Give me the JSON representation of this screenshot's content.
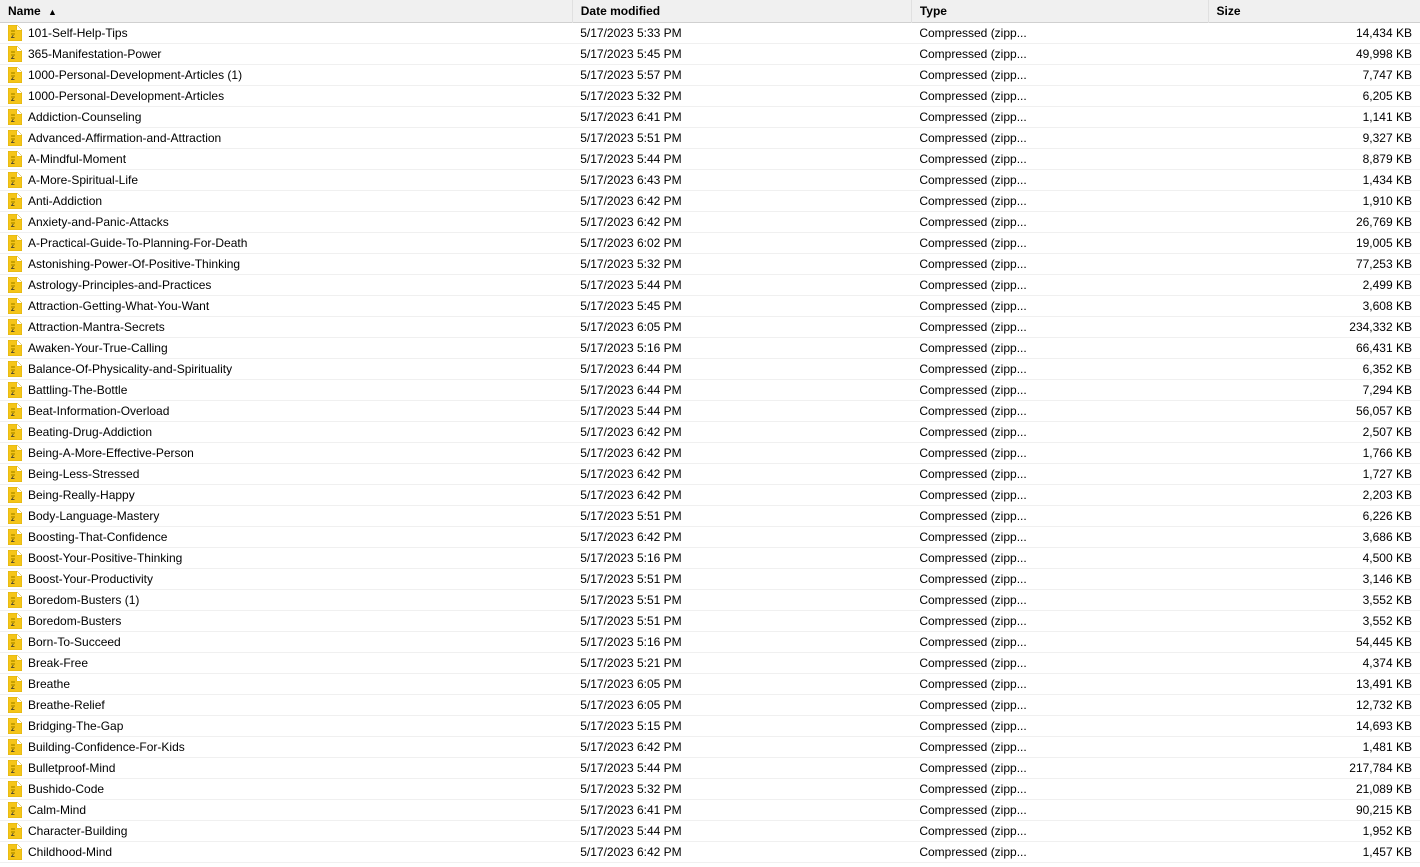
{
  "columns": {
    "name": "Name",
    "date": "Date modified",
    "type": "Type",
    "size": "Size"
  },
  "sort_arrow": "▲",
  "files": [
    {
      "name": "101-Self-Help-Tips",
      "date": "5/17/2023 5:33 PM",
      "type": "Compressed (zipp...",
      "size": "14,434 KB"
    },
    {
      "name": "365-Manifestation-Power",
      "date": "5/17/2023 5:45 PM",
      "type": "Compressed (zipp...",
      "size": "49,998 KB"
    },
    {
      "name": "1000-Personal-Development-Articles (1)",
      "date": "5/17/2023 5:57 PM",
      "type": "Compressed (zipp...",
      "size": "7,747 KB"
    },
    {
      "name": "1000-Personal-Development-Articles",
      "date": "5/17/2023 5:32 PM",
      "type": "Compressed (zipp...",
      "size": "6,205 KB"
    },
    {
      "name": "Addiction-Counseling",
      "date": "5/17/2023 6:41 PM",
      "type": "Compressed (zipp...",
      "size": "1,141 KB"
    },
    {
      "name": "Advanced-Affirmation-and-Attraction",
      "date": "5/17/2023 5:51 PM",
      "type": "Compressed (zipp...",
      "size": "9,327 KB"
    },
    {
      "name": "A-Mindful-Moment",
      "date": "5/17/2023 5:44 PM",
      "type": "Compressed (zipp...",
      "size": "8,879 KB"
    },
    {
      "name": "A-More-Spiritual-Life",
      "date": "5/17/2023 6:43 PM",
      "type": "Compressed (zipp...",
      "size": "1,434 KB"
    },
    {
      "name": "Anti-Addiction",
      "date": "5/17/2023 6:42 PM",
      "type": "Compressed (zipp...",
      "size": "1,910 KB"
    },
    {
      "name": "Anxiety-and-Panic-Attacks",
      "date": "5/17/2023 6:42 PM",
      "type": "Compressed (zipp...",
      "size": "26,769 KB"
    },
    {
      "name": "A-Practical-Guide-To-Planning-For-Death",
      "date": "5/17/2023 6:02 PM",
      "type": "Compressed (zipp...",
      "size": "19,005 KB"
    },
    {
      "name": "Astonishing-Power-Of-Positive-Thinking",
      "date": "5/17/2023 5:32 PM",
      "type": "Compressed (zipp...",
      "size": "77,253 KB"
    },
    {
      "name": "Astrology-Principles-and-Practices",
      "date": "5/17/2023 5:44 PM",
      "type": "Compressed (zipp...",
      "size": "2,499 KB"
    },
    {
      "name": "Attraction-Getting-What-You-Want",
      "date": "5/17/2023 5:45 PM",
      "type": "Compressed (zipp...",
      "size": "3,608 KB"
    },
    {
      "name": "Attraction-Mantra-Secrets",
      "date": "5/17/2023 6:05 PM",
      "type": "Compressed (zipp...",
      "size": "234,332 KB"
    },
    {
      "name": "Awaken-Your-True-Calling",
      "date": "5/17/2023 5:16 PM",
      "type": "Compressed (zipp...",
      "size": "66,431 KB"
    },
    {
      "name": "Balance-Of-Physicality-and-Spirituality",
      "date": "5/17/2023 6:44 PM",
      "type": "Compressed (zipp...",
      "size": "6,352 KB"
    },
    {
      "name": "Battling-The-Bottle",
      "date": "5/17/2023 6:44 PM",
      "type": "Compressed (zipp...",
      "size": "7,294 KB"
    },
    {
      "name": "Beat-Information-Overload",
      "date": "5/17/2023 5:44 PM",
      "type": "Compressed (zipp...",
      "size": "56,057 KB"
    },
    {
      "name": "Beating-Drug-Addiction",
      "date": "5/17/2023 6:42 PM",
      "type": "Compressed (zipp...",
      "size": "2,507 KB"
    },
    {
      "name": "Being-A-More-Effective-Person",
      "date": "5/17/2023 6:42 PM",
      "type": "Compressed (zipp...",
      "size": "1,766 KB"
    },
    {
      "name": "Being-Less-Stressed",
      "date": "5/17/2023 6:42 PM",
      "type": "Compressed (zipp...",
      "size": "1,727 KB"
    },
    {
      "name": "Being-Really-Happy",
      "date": "5/17/2023 6:42 PM",
      "type": "Compressed (zipp...",
      "size": "2,203 KB"
    },
    {
      "name": "Body-Language-Mastery",
      "date": "5/17/2023 5:51 PM",
      "type": "Compressed (zipp...",
      "size": "6,226 KB"
    },
    {
      "name": "Boosting-That-Confidence",
      "date": "5/17/2023 6:42 PM",
      "type": "Compressed (zipp...",
      "size": "3,686 KB"
    },
    {
      "name": "Boost-Your-Positive-Thinking",
      "date": "5/17/2023 5:16 PM",
      "type": "Compressed (zipp...",
      "size": "4,500 KB"
    },
    {
      "name": "Boost-Your-Productivity",
      "date": "5/17/2023 5:51 PM",
      "type": "Compressed (zipp...",
      "size": "3,146 KB"
    },
    {
      "name": "Boredom-Busters (1)",
      "date": "5/17/2023 5:51 PM",
      "type": "Compressed (zipp...",
      "size": "3,552 KB"
    },
    {
      "name": "Boredom-Busters",
      "date": "5/17/2023 5:51 PM",
      "type": "Compressed (zipp...",
      "size": "3,552 KB"
    },
    {
      "name": "Born-To-Succeed",
      "date": "5/17/2023 5:16 PM",
      "type": "Compressed (zipp...",
      "size": "54,445 KB"
    },
    {
      "name": "Break-Free",
      "date": "5/17/2023 5:21 PM",
      "type": "Compressed (zipp...",
      "size": "4,374 KB"
    },
    {
      "name": "Breathe",
      "date": "5/17/2023 6:05 PM",
      "type": "Compressed (zipp...",
      "size": "13,491 KB"
    },
    {
      "name": "Breathe-Relief",
      "date": "5/17/2023 6:05 PM",
      "type": "Compressed (zipp...",
      "size": "12,732 KB"
    },
    {
      "name": "Bridging-The-Gap",
      "date": "5/17/2023 5:15 PM",
      "type": "Compressed (zipp...",
      "size": "14,693 KB"
    },
    {
      "name": "Building-Confidence-For-Kids",
      "date": "5/17/2023 6:42 PM",
      "type": "Compressed (zipp...",
      "size": "1,481 KB"
    },
    {
      "name": "Bulletproof-Mind",
      "date": "5/17/2023 5:44 PM",
      "type": "Compressed (zipp...",
      "size": "217,784 KB"
    },
    {
      "name": "Bushido-Code",
      "date": "5/17/2023 5:32 PM",
      "type": "Compressed (zipp...",
      "size": "21,089 KB"
    },
    {
      "name": "Calm-Mind",
      "date": "5/17/2023 6:41 PM",
      "type": "Compressed (zipp...",
      "size": "90,215 KB"
    },
    {
      "name": "Character-Building",
      "date": "5/17/2023 5:44 PM",
      "type": "Compressed (zipp...",
      "size": "1,952 KB"
    },
    {
      "name": "Childhood-Mind",
      "date": "5/17/2023 6:42 PM",
      "type": "Compressed (zipp...",
      "size": "1,457 KB"
    }
  ]
}
